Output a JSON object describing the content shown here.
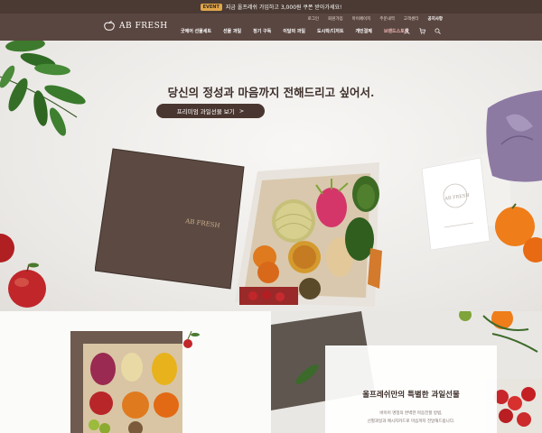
{
  "promo": {
    "badge": "EVENT",
    "text": "지금 올프레쉬 가입하고 3,000원 쿠폰 받아가세요!"
  },
  "header": {
    "logo": "AB FRESH",
    "util_links": [
      "로그인",
      "회원가입",
      "마이페이지",
      "주문내역",
      "고객센터",
      "공지사항"
    ],
    "nav": [
      "굿에어 선물세트",
      "선물 과일",
      "정기 구독",
      "이달의 과일",
      "도시락/디저트",
      "개인결제",
      "브랜드스토리"
    ],
    "icons": [
      "user-icon",
      "cart-icon",
      "search-icon"
    ]
  },
  "hero": {
    "title": "당신의 정성과 마음까지 전해드리고 싶어서.",
    "cta": "프리미엄 과일선물 보기",
    "cta_arrow": ">",
    "giftbox_brand": "AB FRESH",
    "card_text": "AB FRESH"
  },
  "special": {
    "title": "올프레쉬만의 특별한 과일선물",
    "line1": "바이어 명정의 완벽한 마음전할 방법,",
    "line2": "선별과일과 메시지카드로 마음까지 전달해드립니다."
  },
  "colors": {
    "header": "#5a4640",
    "promo": "#4a3a33",
    "cta": "#4a3630",
    "accent_nav": "#f0b8b8"
  }
}
